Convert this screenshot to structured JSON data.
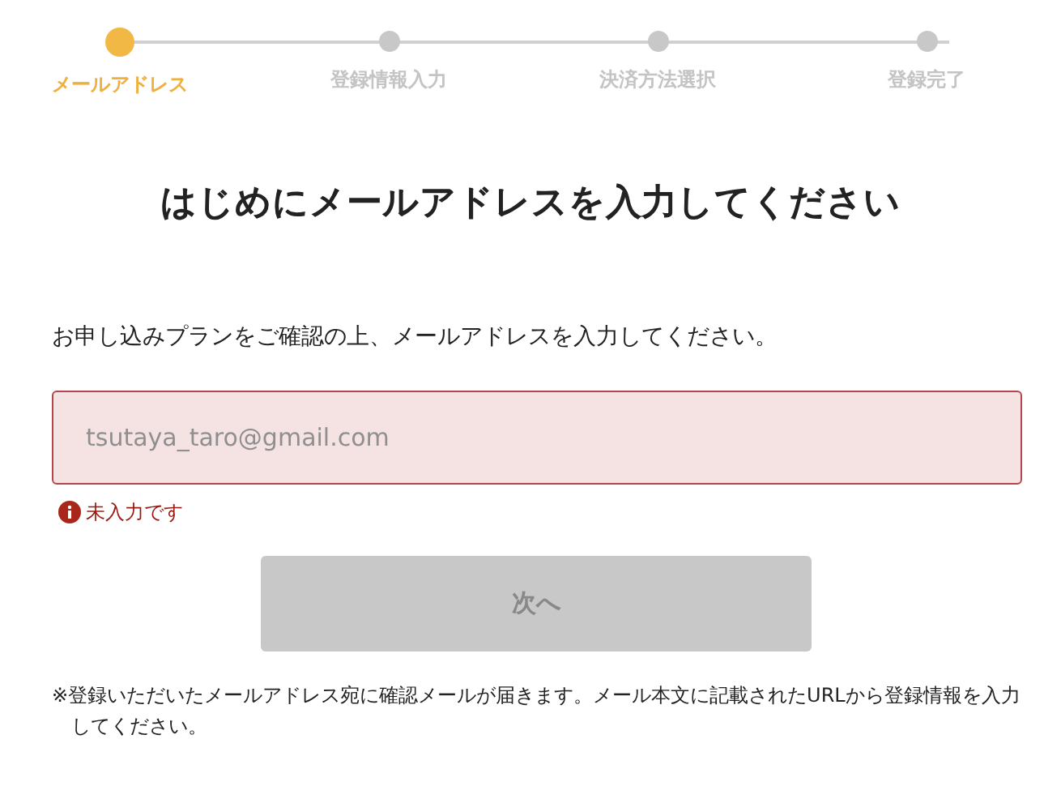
{
  "steps": [
    {
      "label": "メールアドレス",
      "active": true
    },
    {
      "label": "登録情報入力",
      "active": false
    },
    {
      "label": "決済方法選択",
      "active": false
    },
    {
      "label": "登録完了",
      "active": false
    }
  ],
  "heading": "はじめにメールアドレスを入力してください",
  "intro": "お申し込みプランをご確認の上、メールアドレスを入力してください。",
  "email_field": {
    "placeholder": "tsutaya_taro@gmail.com",
    "invalid": true,
    "error": "未入力です"
  },
  "next_button": {
    "label": "次へ",
    "disabled": true
  },
  "note": "※登録いただいたメールアドレス宛に確認メールが届きます。メール本文に記載されたURLから登録情報を入力してください。"
}
